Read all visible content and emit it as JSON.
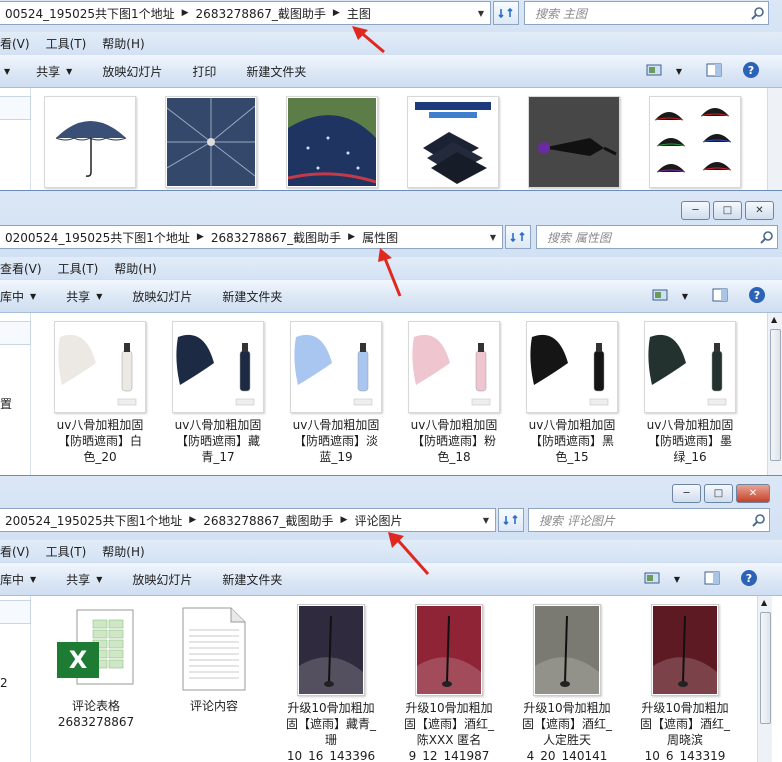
{
  "windows": [
    {
      "id": "main",
      "breadcrumb": [
        "00524_195025共下图1个地址",
        "2683278867_截图助手",
        "主图"
      ],
      "search_placeholder": "搜索 主图",
      "menu": [
        "看(V)",
        "工具(T)",
        "帮助(H)"
      ],
      "toolbar": [
        "共享",
        "放映幻灯片",
        "打印",
        "新建文件夹"
      ],
      "items": [
        {
          "icon": "umbrella-open-navy",
          "caption": ""
        },
        {
          "icon": "umbrella-under-view",
          "caption": ""
        },
        {
          "icon": "umbrella-rain-drops",
          "caption": ""
        },
        {
          "icon": "umbrella-folded-stack",
          "caption": ""
        },
        {
          "icon": "umbrella-closed-dark",
          "caption": ""
        },
        {
          "icon": "umbrella-color-grid",
          "caption": ""
        }
      ]
    },
    {
      "id": "attributes",
      "breadcrumb": [
        "0200524_195025共下图1个地址",
        "2683278867_截图助手",
        "属性图"
      ],
      "search_placeholder": "搜索 属性图",
      "menu": [
        "查看(V)",
        "工具(T)",
        "帮助(H)"
      ],
      "toolbar": [
        "库中",
        "共享",
        "放映幻灯片",
        "新建文件夹"
      ],
      "nav_label": "置",
      "items": [
        {
          "caption": [
            "uv八骨加粗加固",
            "【防晒遮雨】白",
            "色_20"
          ],
          "color": "#ece8e4"
        },
        {
          "caption": [
            "uv八骨加粗加固",
            "【防晒遮雨】藏",
            "青_17"
          ],
          "color": "#1d2a44"
        },
        {
          "caption": [
            "uv八骨加粗加固",
            "【防晒遮雨】淡",
            "蓝_19"
          ],
          "color": "#a8c6ef"
        },
        {
          "caption": [
            "uv八骨加粗加固",
            "【防晒遮雨】粉",
            "色_18"
          ],
          "color": "#efc6cf"
        },
        {
          "caption": [
            "uv八骨加粗加固",
            "【防晒遮雨】黑",
            "色_15"
          ],
          "color": "#151515"
        },
        {
          "caption": [
            "uv八骨加粗加固",
            "【防晒遮雨】墨",
            "绿_16"
          ],
          "color": "#23322f"
        }
      ]
    },
    {
      "id": "reviews",
      "breadcrumb": [
        "200524_195025共下图1个地址",
        "2683278867_截图助手",
        "评论图片"
      ],
      "search_placeholder": "搜索 评论图片",
      "menu": [
        "看(V)",
        "工具(T)",
        "帮助(H)"
      ],
      "toolbar": [
        "库中",
        "共享",
        "放映幻灯片",
        "新建文件夹"
      ],
      "nav_label": "2",
      "items": [
        {
          "caption": [
            "评论表格",
            "2683278867"
          ],
          "kind": "excel"
        },
        {
          "caption": [
            "评论内容"
          ],
          "kind": "text"
        },
        {
          "caption": [
            "升级10骨加粗加",
            "固【遮雨】藏青_",
            "珊",
            "10_16_143396"
          ],
          "kind": "photo",
          "color": "#2f2a3e"
        },
        {
          "caption": [
            "升级10骨加粗加",
            "固【遮雨】酒红_",
            "陈XXX 匿名",
            "9_12_141987"
          ],
          "kind": "photo",
          "color": "#8e2436"
        },
        {
          "caption": [
            "升级10骨加粗加",
            "固【遮雨】酒红_",
            "人定胜天",
            "4_20_140141"
          ],
          "kind": "photo",
          "color": "#7a7a72"
        },
        {
          "caption": [
            "升级10骨加粗加",
            "固【遮雨】酒红_",
            "周晓滨",
            "10_6_143319"
          ],
          "kind": "photo",
          "color": "#5e1a22"
        }
      ]
    }
  ]
}
